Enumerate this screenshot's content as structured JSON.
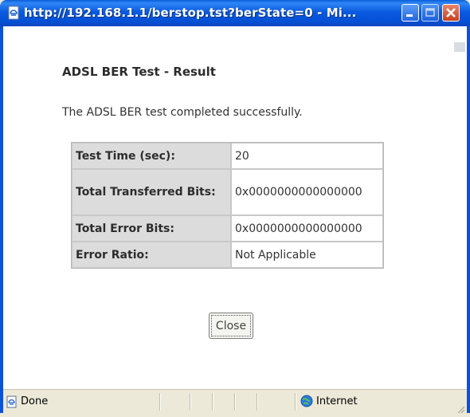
{
  "window": {
    "title": "http://192.168.1.1/berstop.tst?berState=0 - Mi..."
  },
  "page": {
    "heading": "ADSL BER Test - Result",
    "message": "The ADSL BER test completed successfully."
  },
  "results": [
    {
      "label": "Test Time (sec):",
      "value": "20"
    },
    {
      "label": "Total Transferred Bits:",
      "value": "0x0000000000000000"
    },
    {
      "label": "Total Error Bits:",
      "value": "0x0000000000000000"
    },
    {
      "label": "Error Ratio:",
      "value": "Not Applicable"
    }
  ],
  "buttons": {
    "close_label": "Close"
  },
  "statusbar": {
    "status": "Done",
    "zone": "Internet"
  },
  "colors": {
    "titlebar": "#0a5ae0",
    "label_cell_bg": "#dcdcdc",
    "status_bg": "#ece9d8"
  },
  "icons": {
    "title": "ie-page-icon",
    "status": "page-done-icon",
    "zone": "globe-icon"
  }
}
